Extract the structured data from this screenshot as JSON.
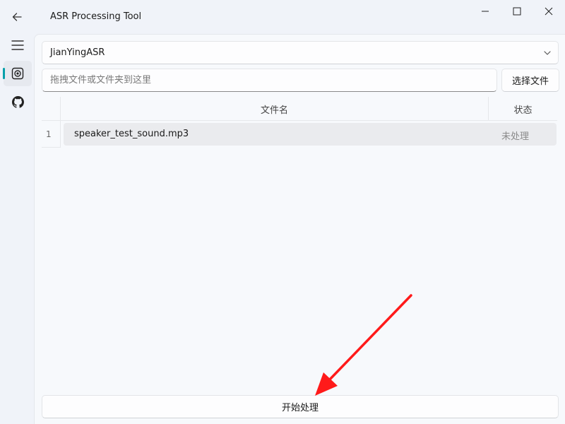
{
  "window": {
    "title": "ASR Processing Tool",
    "controls": [
      "minimize",
      "maximize",
      "close"
    ]
  },
  "sidebar": {
    "items": [
      {
        "icon": "hamburger-menu-icon",
        "active": false
      },
      {
        "icon": "target-icon",
        "active": true
      },
      {
        "icon": "github-icon",
        "active": false
      }
    ],
    "accent": "#009faa"
  },
  "engine_select": {
    "value": "JianYingASR"
  },
  "file_input": {
    "value": "",
    "placeholder": "拖拽文件或文件夹到这里"
  },
  "choose_file_label": "选择文件",
  "table": {
    "headers": [
      "文件名",
      "状态"
    ],
    "rows": [
      {
        "index": "1",
        "filename": "speaker_test_sound.mp3",
        "status": "未处理"
      }
    ]
  },
  "start_button_label": "开始处理",
  "annotation": {
    "arrow_color": "#ff1a1a"
  }
}
